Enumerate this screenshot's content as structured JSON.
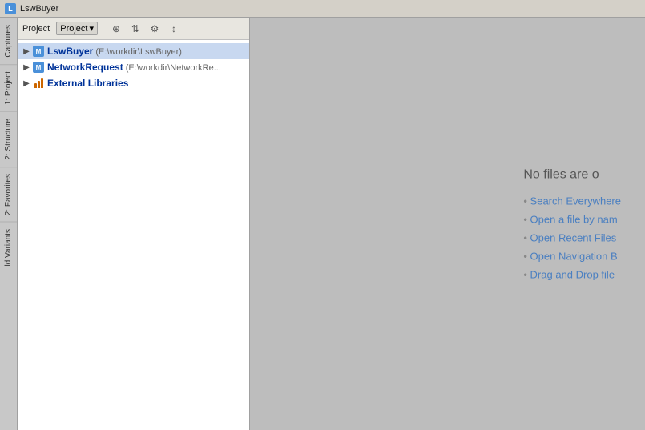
{
  "titleBar": {
    "text": "LswBuyer"
  },
  "sidebar": {
    "tabs": [
      {
        "id": "captures",
        "label": "Captures"
      },
      {
        "id": "project",
        "label": "1: Project"
      },
      {
        "id": "structure",
        "label": "2: Structure"
      },
      {
        "id": "favorites",
        "label": "2: Favorites"
      },
      {
        "id": "build-variants",
        "label": "ld Variants"
      }
    ]
  },
  "projectPanel": {
    "toolbar": {
      "label": "Project",
      "dropdownLabel": "Project",
      "buttons": [
        {
          "id": "btn1",
          "icon": "⊕",
          "title": "Add"
        },
        {
          "id": "btn2",
          "icon": "⇅",
          "title": "Sort"
        },
        {
          "id": "btn3",
          "icon": "⚙",
          "title": "Settings"
        },
        {
          "id": "btn4",
          "icon": "↕",
          "title": "Expand"
        }
      ]
    },
    "tree": [
      {
        "id": "lswbuyer",
        "name": "LswBuyer",
        "path": "(E:\\workdir\\LswBuyer)",
        "type": "module",
        "expanded": true,
        "level": 0
      },
      {
        "id": "networkrequest",
        "name": "NetworkRequest",
        "path": "(E:\\workdir\\NetworkRe...",
        "type": "module",
        "expanded": false,
        "level": 0
      },
      {
        "id": "external-libraries",
        "name": "External Libraries",
        "path": "",
        "type": "library",
        "expanded": false,
        "level": 0
      }
    ]
  },
  "mainContent": {
    "noFilesTitle": "No files are o",
    "suggestions": [
      {
        "id": "search",
        "text": "Search Everywhere"
      },
      {
        "id": "open-name",
        "text": "Open a file by nam"
      },
      {
        "id": "recent",
        "text": "Open Recent Files"
      },
      {
        "id": "navigation",
        "text": "Open Navigation B"
      },
      {
        "id": "drag-drop",
        "text": "Drag and Drop file"
      }
    ]
  }
}
